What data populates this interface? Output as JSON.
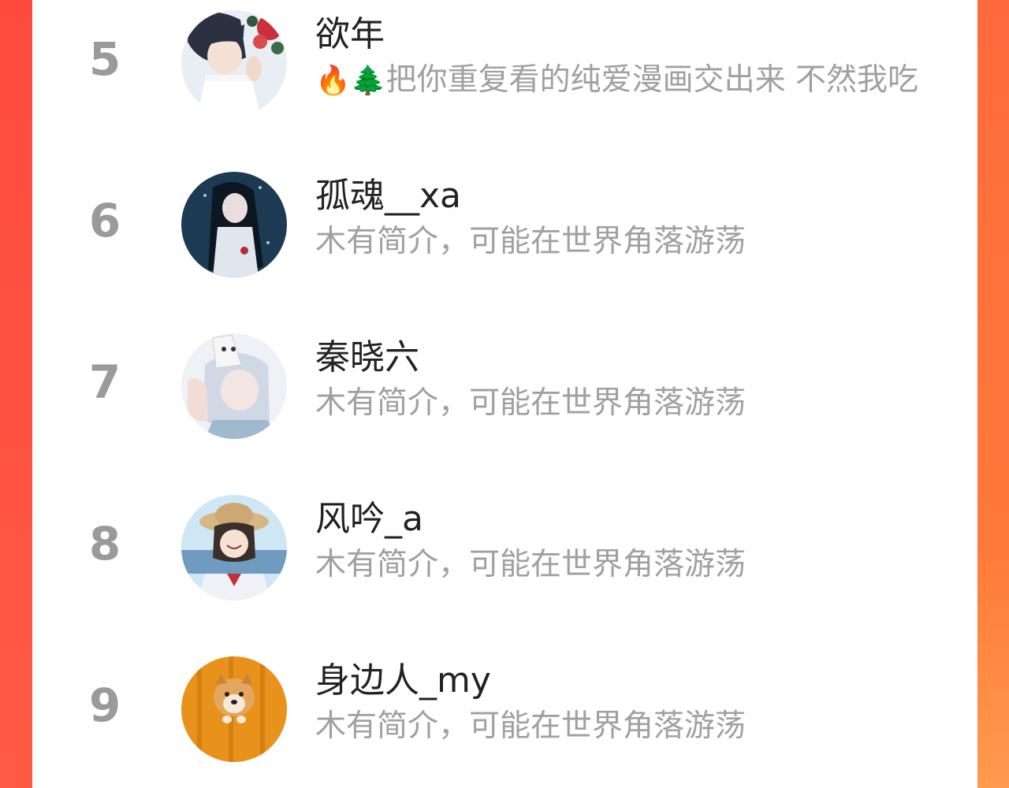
{
  "ranking": {
    "items": [
      {
        "rank": "5",
        "name": "欲年",
        "bio_emoji": "🔥🌲",
        "bio": "把你重复看的纯爱漫画交出来 不然我吃",
        "avatar": "avatar-anime-boy-flowers"
      },
      {
        "rank": "6",
        "name": "孤魂__xa",
        "bio_emoji": "",
        "bio": "木有简介，可能在世界角落游荡",
        "avatar": "avatar-anime-girl-dark"
      },
      {
        "rank": "7",
        "name": "秦晓六",
        "bio_emoji": "",
        "bio": "木有简介，可能在世界角落游荡",
        "avatar": "avatar-anime-fox-mask"
      },
      {
        "rank": "8",
        "name": "风吟_a",
        "bio_emoji": "",
        "bio": "木有简介，可能在世界角落游荡",
        "avatar": "avatar-anime-girl-straw-hat"
      },
      {
        "rank": "9",
        "name": "身边人_my",
        "bio_emoji": "",
        "bio": "木有简介，可能在世界角落游荡",
        "avatar": "avatar-shiba-dog"
      }
    ]
  },
  "colors": {
    "side_left": "#fe4b40",
    "side_right": "#ff7a3a",
    "rank_text": "#9a9a9a",
    "name_text": "#222222",
    "bio_text": "#a0a0a0"
  }
}
